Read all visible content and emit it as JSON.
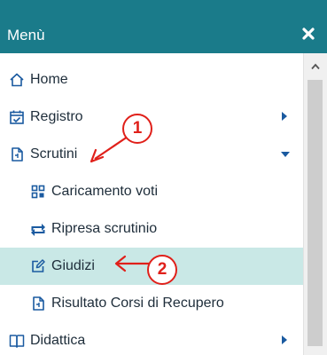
{
  "header": {
    "title": "Menù",
    "background": "#1a7b8a",
    "close_icon": "close-icon"
  },
  "menu": {
    "items": [
      {
        "label": "Home",
        "icon": "home-icon",
        "level": "top",
        "indicator": "none"
      },
      {
        "label": "Registro",
        "icon": "calendar-check-icon",
        "level": "top",
        "indicator": "collapsed"
      },
      {
        "label": "Scrutini",
        "icon": "document-icon",
        "level": "top",
        "indicator": "expanded"
      },
      {
        "label": "Caricamento voti",
        "icon": "grid-icon",
        "level": "sub",
        "indicator": "none"
      },
      {
        "label": "Ripresa scrutinio",
        "icon": "transfer-icon",
        "level": "sub",
        "indicator": "none"
      },
      {
        "label": "Giudizi",
        "icon": "edit-icon",
        "level": "sub",
        "indicator": "none",
        "active": true
      },
      {
        "label": "Risultato Corsi di Recupero",
        "icon": "document-icon",
        "level": "sub",
        "indicator": "none"
      },
      {
        "label": "Didattica",
        "icon": "book-icon",
        "level": "top",
        "indicator": "collapsed"
      }
    ],
    "active_background": "#c9e8e6",
    "accent_color": "#1a5aa0"
  },
  "annotations": [
    {
      "number": "1",
      "target": "Scrutini"
    },
    {
      "number": "2",
      "target": "Giudizi"
    }
  ],
  "annotation_color": "#e0201a"
}
